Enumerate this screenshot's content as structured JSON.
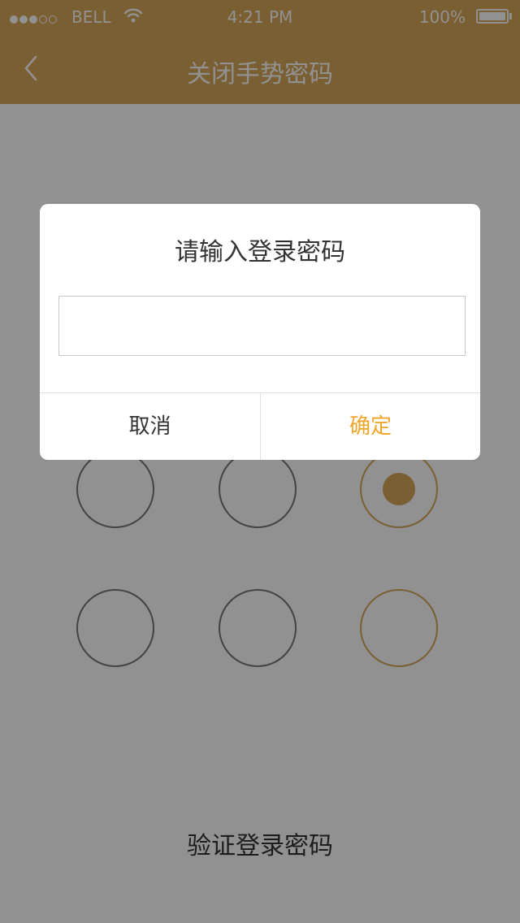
{
  "status_bar": {
    "carrier": "BELL",
    "time": "4:21 PM",
    "battery_percent": "100%",
    "signal_icon": "signal-dots-icon",
    "wifi_icon": "wifi-icon",
    "battery_icon": "battery-icon"
  },
  "nav": {
    "title": "关闭手势密码",
    "back_icon": "chevron-left-icon"
  },
  "colors": {
    "accent": "#d6a75a",
    "confirm_text": "#f1a62a",
    "circle_border": "#777777",
    "overlay": "rgba(0,0,0,0.43)"
  },
  "gesture": {
    "rows_visible": 2,
    "columns": 3,
    "active_nodes": [
      {
        "row": 1,
        "col": 3,
        "selected": true
      },
      {
        "row": 2,
        "col": 3,
        "selected": false
      }
    ]
  },
  "verify_link": "验证登录密码",
  "dialog": {
    "title": "请输入登录密码",
    "input_value": "",
    "input_placeholder": "",
    "cancel_label": "取消",
    "confirm_label": "确定"
  }
}
